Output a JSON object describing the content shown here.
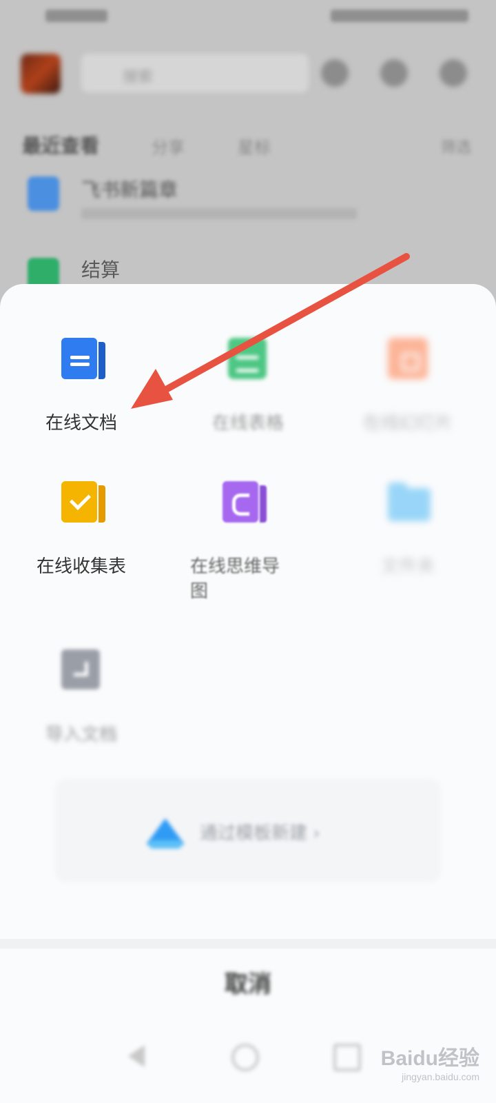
{
  "background": {
    "search_placeholder": "搜索",
    "tabs": {
      "main": "最近查看",
      "tab2": "分享",
      "tab3": "星标",
      "more": "筛选"
    },
    "files": [
      {
        "title": "飞书新篇章",
        "icon": "doc-icon",
        "color": "#4a8fe0"
      },
      {
        "title": "结算",
        "icon": "sheet-icon",
        "color": "#2fae6a"
      }
    ]
  },
  "sheet": {
    "items": [
      {
        "label": "在线文档",
        "icon": "online-doc-icon",
        "color": "#2f7bf0"
      },
      {
        "label": "在线表格",
        "icon": "online-sheet-icon",
        "color": "#2fbe6f"
      },
      {
        "label": "在线幻灯片",
        "icon": "online-slides-icon",
        "color": "#ff7a45"
      },
      {
        "label": "在线收集表",
        "icon": "online-form-icon",
        "color": "#f5b400"
      },
      {
        "label": "在线思维导图",
        "icon": "online-mindmap-icon",
        "color": "#a768f0"
      },
      {
        "label": "文件夹",
        "icon": "folder-icon",
        "color": "#49b7f5"
      },
      {
        "label": "导入文档",
        "icon": "import-icon",
        "color": "#8a8f99"
      }
    ],
    "banner_text": "通过模板新建 ›",
    "cancel_label": "取消"
  },
  "annotation": {
    "arrow_color": "#e85240"
  },
  "watermark": {
    "main": "Baidu经验",
    "sub": "jingyan.baidu.com"
  }
}
